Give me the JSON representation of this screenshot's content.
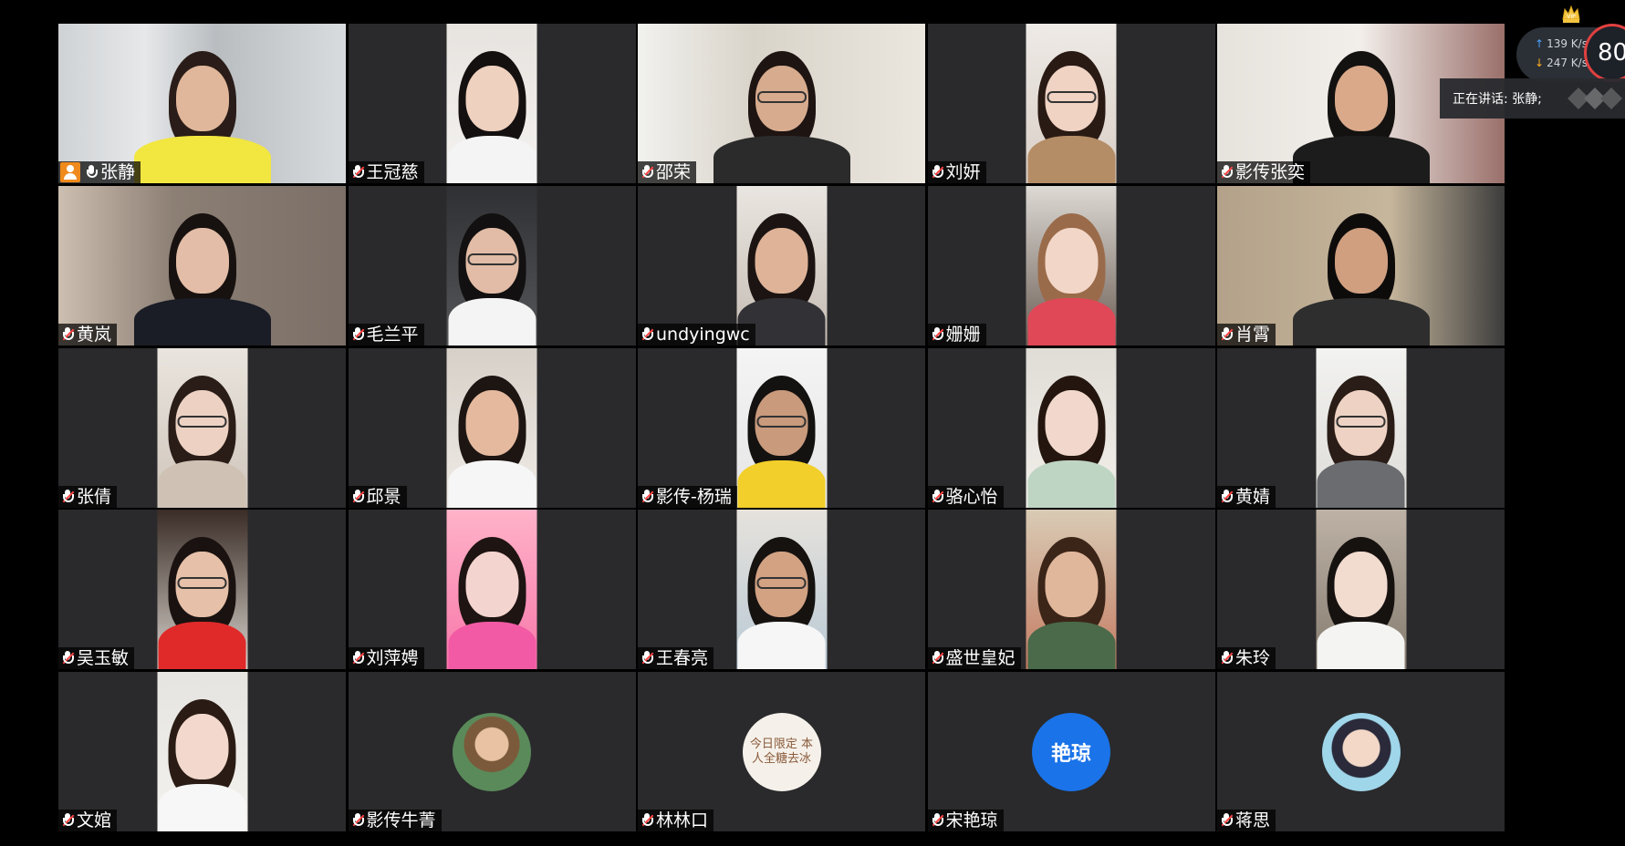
{
  "meeting": {
    "participants": [
      {
        "name": "张静",
        "host": true,
        "mic": "on",
        "view": "video",
        "active": true
      },
      {
        "name": "王冠慈",
        "mic": "muted",
        "view": "video"
      },
      {
        "name": "邵荣",
        "mic": "muted",
        "view": "video"
      },
      {
        "name": "刘妍",
        "mic": "muted",
        "view": "video"
      },
      {
        "name": "影传张奕",
        "mic": "muted",
        "view": "video"
      },
      {
        "name": "黄岚",
        "mic": "muted",
        "view": "video"
      },
      {
        "name": "毛兰平",
        "mic": "muted",
        "view": "video"
      },
      {
        "name": "undyingwc",
        "mic": "muted",
        "view": "video"
      },
      {
        "name": "姗姗",
        "mic": "muted",
        "view": "video"
      },
      {
        "name": "肖霄",
        "mic": "muted",
        "view": "video"
      },
      {
        "name": "张倩",
        "mic": "muted",
        "view": "video"
      },
      {
        "name": "邱景",
        "mic": "muted",
        "view": "video"
      },
      {
        "name": "影传-杨瑞",
        "mic": "muted",
        "view": "video"
      },
      {
        "name": "骆心怡",
        "mic": "muted",
        "view": "video"
      },
      {
        "name": "黄婧",
        "mic": "muted",
        "view": "video"
      },
      {
        "name": "吴玉敏",
        "mic": "muted",
        "view": "video"
      },
      {
        "name": "刘萍娉",
        "mic": "muted",
        "view": "video"
      },
      {
        "name": "王春亮",
        "mic": "muted",
        "view": "video"
      },
      {
        "name": "盛世皇妃",
        "mic": "muted",
        "view": "video"
      },
      {
        "name": "朱玲",
        "mic": "muted",
        "view": "video"
      },
      {
        "name": "文婠",
        "mic": "muted",
        "view": "video"
      },
      {
        "name": "影传牛菁",
        "mic": "muted",
        "view": "avatar"
      },
      {
        "name": "林林口",
        "mic": "muted",
        "view": "avatar",
        "avatar_text": "今日限定 本人全糖去冰"
      },
      {
        "name": "宋艳琼",
        "mic": "muted",
        "view": "avatar",
        "avatar_text": "艳琼",
        "avatar_color": "#1a73e8"
      },
      {
        "name": "蒋思",
        "mic": "muted",
        "view": "avatar"
      }
    ]
  },
  "network": {
    "upload": "139 K/s",
    "download": "247 K/s",
    "speed": "80"
  },
  "speaking": {
    "label": "正在讲话: 张静;"
  },
  "colors": {
    "active_border": "#2fbd5a",
    "tile_bg": "#2a2a2c",
    "muted_mic": "#ff4444",
    "host_badge": "#f08a1c",
    "avatar_blue": "#1a73e8"
  }
}
